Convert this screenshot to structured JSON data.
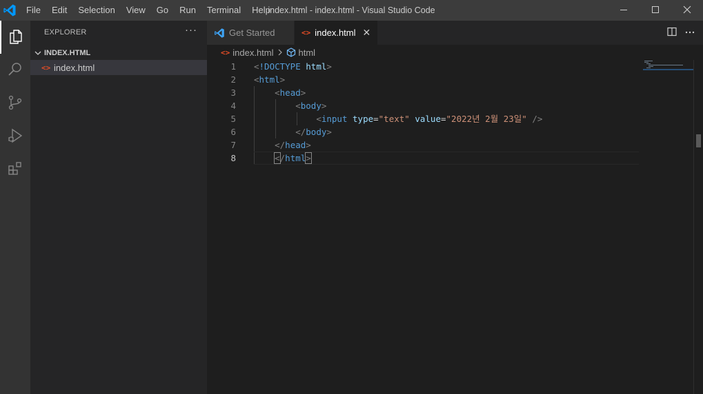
{
  "window": {
    "title": "index.html - index.html - Visual Studio Code",
    "menu": [
      "File",
      "Edit",
      "Selection",
      "View",
      "Go",
      "Run",
      "Terminal",
      "Help"
    ],
    "controls": [
      "minimize-icon",
      "maximize-icon",
      "close-icon"
    ]
  },
  "activity_bar": {
    "items": [
      "explorer-icon",
      "search-icon",
      "source-control-icon",
      "run-debug-icon",
      "extensions-icon"
    ],
    "active": "explorer-icon"
  },
  "sidebar": {
    "title": "EXPLORER",
    "more": "···",
    "folder": "INDEX.HTML",
    "file_icon": "<>",
    "files": [
      "index.html"
    ]
  },
  "tabs": [
    {
      "label": "Get Started",
      "icon": "vscode-logo-icon",
      "active": false
    },
    {
      "label": "index.html",
      "icon": "html-file-icon",
      "active": true,
      "close": "✕"
    }
  ],
  "tab_actions": [
    "split-editor-icon",
    "more-actions-icon"
  ],
  "breadcrumb": {
    "file_icon": "<>",
    "file": "index.html",
    "symbol": "html"
  },
  "editor": {
    "line_numbers": [
      "1",
      "2",
      "3",
      "4",
      "5",
      "6",
      "7",
      "8"
    ],
    "current_line": "8",
    "lines": {
      "l1": {
        "open": "<",
        "decl": "!DOCTYPE",
        "sp": " ",
        "name": "html",
        "close": ">"
      },
      "l2": {
        "open": "<",
        "tag": "html",
        "close": ">"
      },
      "l3": {
        "indent": "    ",
        "open": "<",
        "tag": "head",
        "close": ">"
      },
      "l4": {
        "indent": "        ",
        "open": "<",
        "tag": "body",
        "close": ">"
      },
      "l5": {
        "indent": "            ",
        "open": "<",
        "tag": "input",
        "sp1": " ",
        "attr1": "type",
        "eq1": "=",
        "val1": "\"text\"",
        "sp2": " ",
        "attr2": "value",
        "eq2": "=",
        "val2": "\"2022년 2월 23일\"",
        "sp3": " ",
        "close": "/>"
      },
      "l6": {
        "indent": "        ",
        "open": "</",
        "tag": "body",
        "close": ">"
      },
      "l7": {
        "indent": "    ",
        "open": "</",
        "tag": "head",
        "close": ">"
      },
      "l8": {
        "indent": "    ",
        "open": "<",
        "slash": "/",
        "tag": "html",
        "close": ">"
      }
    }
  },
  "colors": {
    "tag": "#569cd6",
    "attribute": "#9cdcfe",
    "string": "#ce9178",
    "punctuation": "#808080",
    "accent": "#007acc"
  }
}
